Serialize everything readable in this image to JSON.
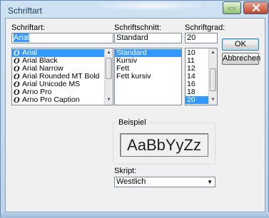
{
  "window": {
    "title": "Schriftart",
    "minimize_icon": "minimize-icon",
    "close_icon": "close-icon"
  },
  "font": {
    "label": "Schriftart:",
    "value": "Arial",
    "items": [
      "Arial",
      "Arial Black",
      "Arial Narrow",
      "Arial Rounded MT Bold",
      "Arial Unicode MS",
      "Arno Pro",
      "Arno Pro Caption"
    ],
    "item_icon": "opentype-font-icon"
  },
  "style": {
    "label": "Schriftschnitt:",
    "value": "Standard",
    "items": [
      "Standard",
      "Kursiv",
      "Fett",
      "Fett kursiv"
    ]
  },
  "size": {
    "label": "Schriftgrad:",
    "value": "20",
    "items": [
      "10",
      "11",
      "12",
      "14",
      "16",
      "18",
      "20"
    ]
  },
  "buttons": {
    "ok": "OK",
    "cancel": "Abbrechen"
  },
  "sample": {
    "group_label": "Beispiel",
    "text": "AaBbYyZz"
  },
  "script": {
    "label": "Skript:",
    "value": "Westlich"
  }
}
